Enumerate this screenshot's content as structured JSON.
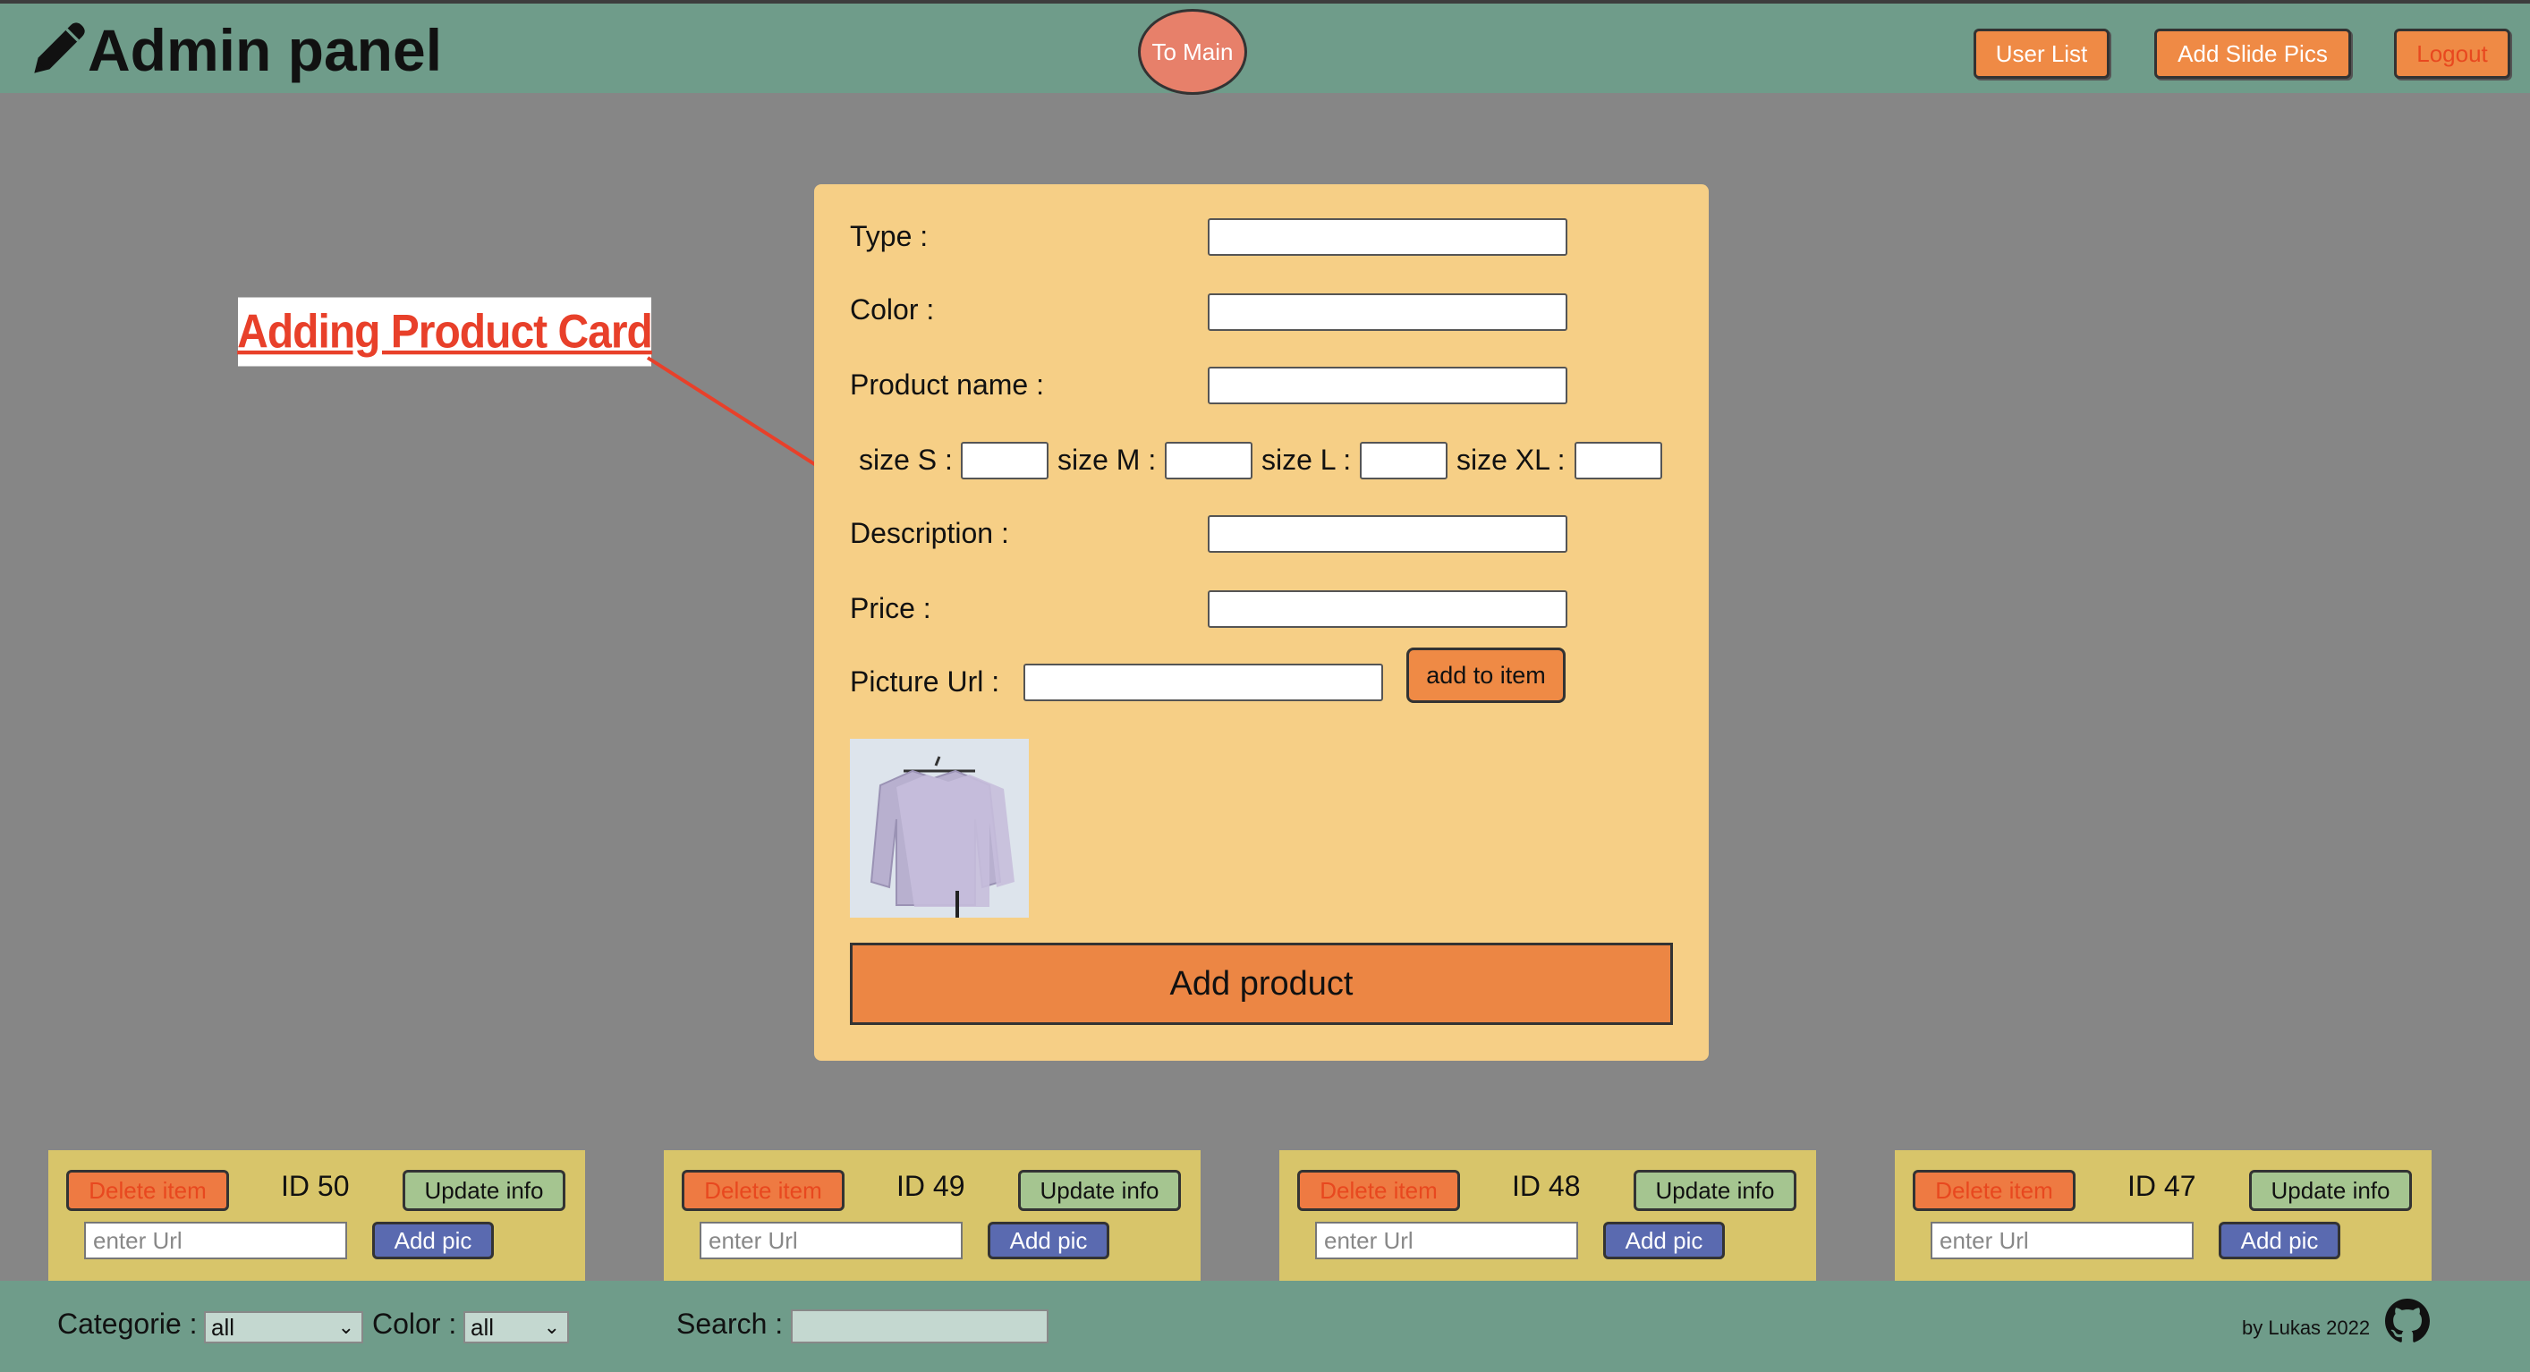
{
  "header": {
    "title": "Admin panel",
    "to_main": "To Main",
    "buttons": {
      "user_list": "User List",
      "add_slide_pics": "Add Slide Pics",
      "logout": "Logout"
    }
  },
  "annotation": {
    "label": "Adding Product Card"
  },
  "form": {
    "type_label": "Type :",
    "color_label": "Color :",
    "product_name_label": "Product name :",
    "sizes": [
      "size S :",
      "size M :",
      "size L :",
      "size XL :"
    ],
    "description_label": "Description :",
    "price_label": "Price :",
    "picture_url_label": "Picture Url :",
    "add_to_item": "add to item",
    "add_product": "Add product"
  },
  "cards": [
    {
      "delete": "Delete item",
      "id": "ID 50",
      "update": "Update info",
      "url_placeholder": "enter Url",
      "add_pic": "Add pic"
    },
    {
      "delete": "Delete item",
      "id": "ID 49",
      "update": "Update info",
      "url_placeholder": "enter Url",
      "add_pic": "Add pic"
    },
    {
      "delete": "Delete item",
      "id": "ID 48",
      "update": "Update info",
      "url_placeholder": "enter Url",
      "add_pic": "Add pic"
    },
    {
      "delete": "Delete item",
      "id": "ID 47",
      "update": "Update info",
      "url_placeholder": "enter Url",
      "add_pic": "Add pic"
    }
  ],
  "footer": {
    "categorie_label": "Categorie :",
    "categorie_value": "all",
    "color_label": "Color :",
    "color_value": "all",
    "search_label": "Search :",
    "byline": "by Lukas 2022"
  },
  "icons": {
    "logo": "pencil-icon",
    "footer": "github-icon"
  },
  "colors": {
    "header_bg": "#6f9c8a",
    "page_bg": "#868686",
    "form_bg": "#f6cf86",
    "accent_orange": "#ef8a45",
    "card_bg": "#d8c56a",
    "annotation_red": "#e8402a"
  }
}
